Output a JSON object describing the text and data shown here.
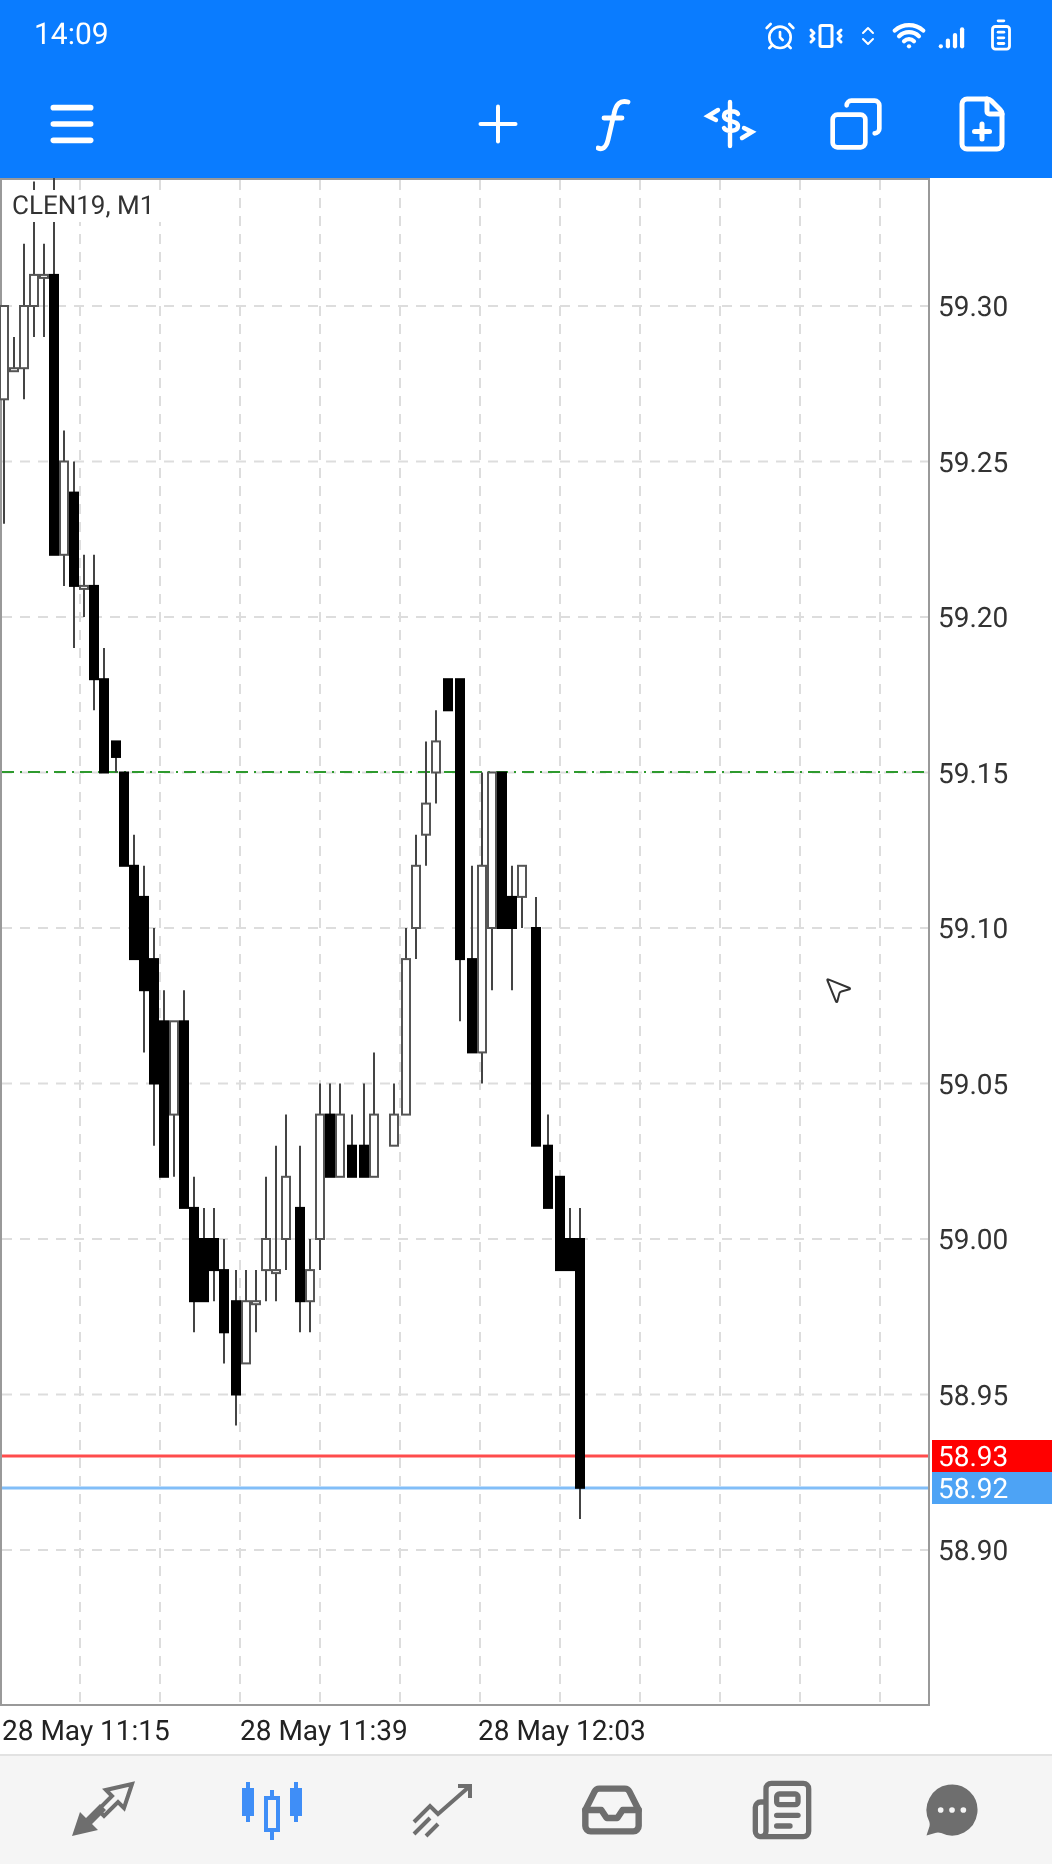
{
  "status_bar": {
    "time": "14:09"
  },
  "chart": {
    "symbol": "CLEN19, M1",
    "price_labels": [
      "59.30",
      "59.25",
      "59.20",
      "59.15",
      "59.10",
      "59.05",
      "59.00",
      "58.95",
      "58.90"
    ],
    "price_tags": [
      {
        "text": "58.93",
        "color": "#ff0000"
      },
      {
        "text": "58.92",
        "color": "#4da3f5"
      }
    ],
    "time_labels": [
      "28 May 11:15",
      "28 May 11:39",
      "28 May 12:03"
    ]
  },
  "bottom_nav": [
    {
      "selected": false
    },
    {
      "selected": true
    },
    {
      "selected": false
    },
    {
      "selected": false
    },
    {
      "selected": false
    },
    {
      "selected": false
    }
  ]
}
